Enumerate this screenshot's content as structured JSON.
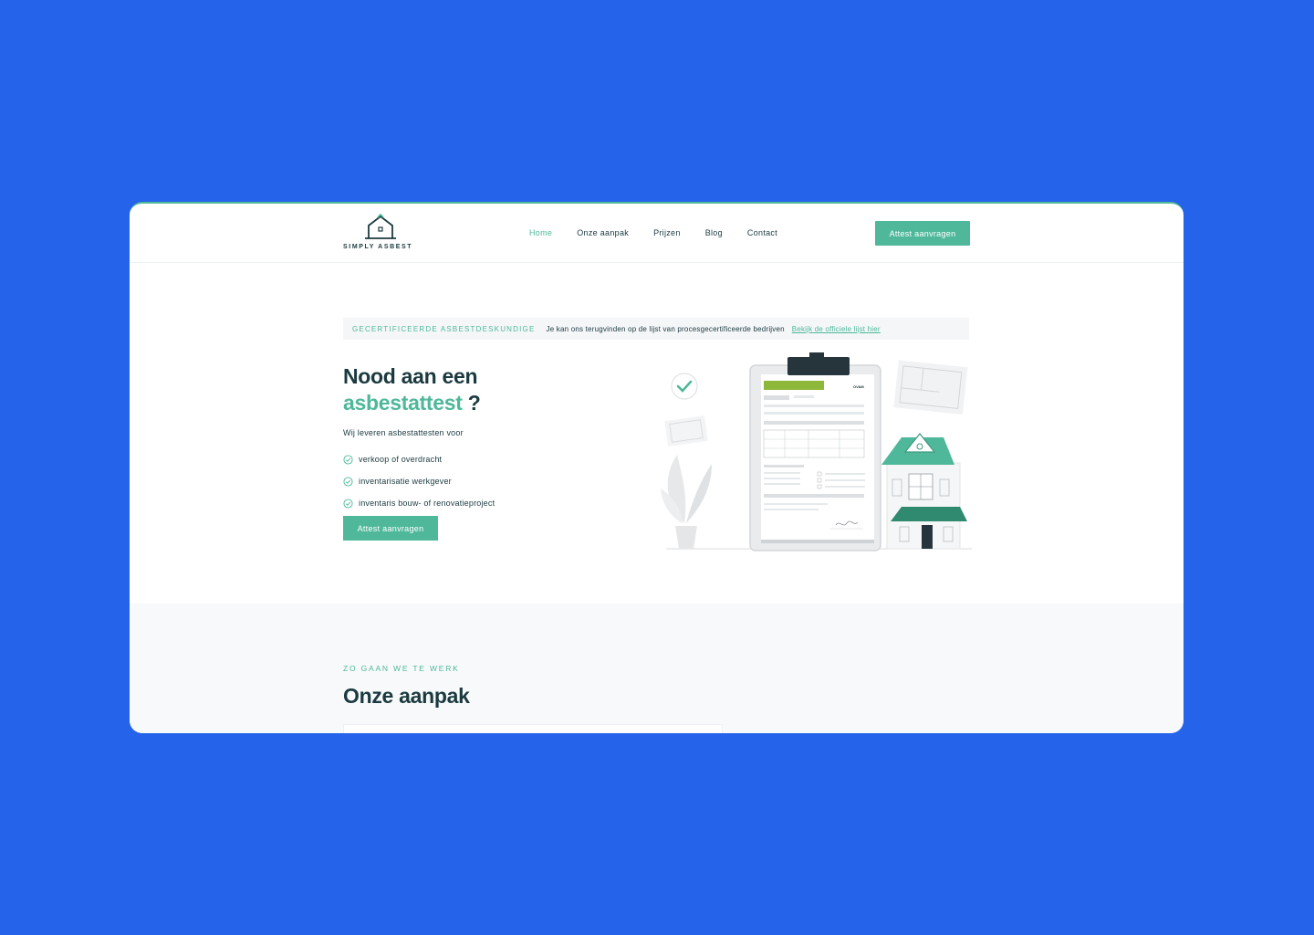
{
  "brand": {
    "name": "SIMPLY ASBEST",
    "accent": "#4fb89a",
    "dark": "#1b3a3f",
    "background": "#2563eb"
  },
  "nav": {
    "items": [
      {
        "label": "Home",
        "active": true
      },
      {
        "label": "Onze aanpak",
        "active": false
      },
      {
        "label": "Prijzen",
        "active": false
      },
      {
        "label": "Blog",
        "active": false
      },
      {
        "label": "Contact",
        "active": false
      }
    ],
    "cta": "Attest aanvragen"
  },
  "banner": {
    "tag": "GECERTIFICEERDE ASBESTDESKUNDIGE",
    "text": "Je kan ons terugvinden op de lijst van procesgecertificeerde bedrijven",
    "link": "Bekijk de officiele lijst hier"
  },
  "hero": {
    "title_line1": "Nood aan een",
    "title_accent": "asbestattest",
    "title_suffix": " ?",
    "intro": "Wij leveren asbestattesten voor",
    "checks": [
      "verkoop of overdracht",
      "inventarisatie werkgever",
      "inventaris bouw- of renovatieproject"
    ],
    "cta": "Attest aanvragen",
    "illustration_logo": "OVAM"
  },
  "section2": {
    "eyebrow": "ZO GAAN WE TE WERK",
    "title": "Onze aanpak"
  }
}
